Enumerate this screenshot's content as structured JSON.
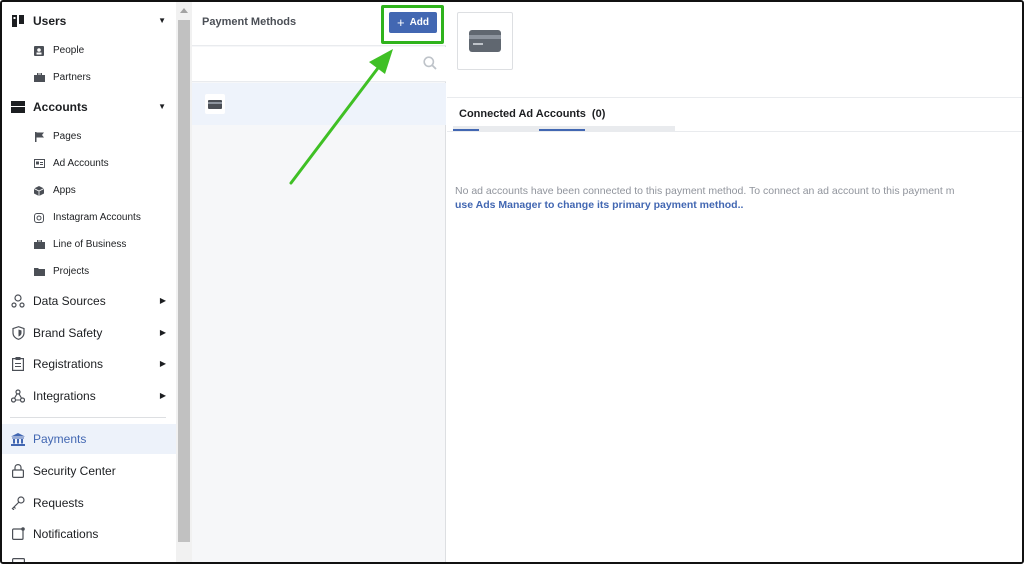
{
  "sidebar": {
    "sections": [
      {
        "label": "Users",
        "icon": "users-icon",
        "expanded": true
      },
      {
        "label": "Accounts",
        "icon": "briefcase-icon",
        "expanded": true
      }
    ],
    "users_items": [
      {
        "label": "People",
        "icon": "person-icon"
      },
      {
        "label": "Partners",
        "icon": "partners-icon"
      }
    ],
    "accounts_items": [
      {
        "label": "Pages",
        "icon": "flag-icon"
      },
      {
        "label": "Ad Accounts",
        "icon": "ad-account-icon"
      },
      {
        "label": "Apps",
        "icon": "cube-icon"
      },
      {
        "label": "Instagram Accounts",
        "icon": "instagram-icon"
      },
      {
        "label": "Line of Business",
        "icon": "briefcase-icon"
      },
      {
        "label": "Projects",
        "icon": "folder-icon"
      }
    ],
    "more_items": [
      {
        "label": "Data Sources",
        "icon": "data-sources-icon"
      },
      {
        "label": "Brand Safety",
        "icon": "shield-icon"
      },
      {
        "label": "Registrations",
        "icon": "clipboard-icon"
      },
      {
        "label": "Integrations",
        "icon": "integrations-icon"
      }
    ],
    "bottom_items": [
      {
        "label": "Payments",
        "icon": "bank-icon",
        "active": true
      },
      {
        "label": "Security Center",
        "icon": "lock-icon"
      },
      {
        "label": "Requests",
        "icon": "key-icon"
      },
      {
        "label": "Notifications",
        "icon": "notification-icon"
      }
    ]
  },
  "payment_methods": {
    "title": "Payment Methods",
    "add_label": "Add",
    "items": [
      {
        "icon": "credit-card-icon"
      }
    ]
  },
  "detail": {
    "tab_label": "Connected Ad Accounts",
    "tab_count": "(0)",
    "empty_message": "No ad accounts have been connected to this payment method. To connect an ad account to this payment m",
    "empty_link": "use Ads Manager to change its primary payment method.."
  },
  "colors": {
    "accent": "#4267b2",
    "highlight": "#2fb31c",
    "active_bg": "#edf2fa"
  }
}
